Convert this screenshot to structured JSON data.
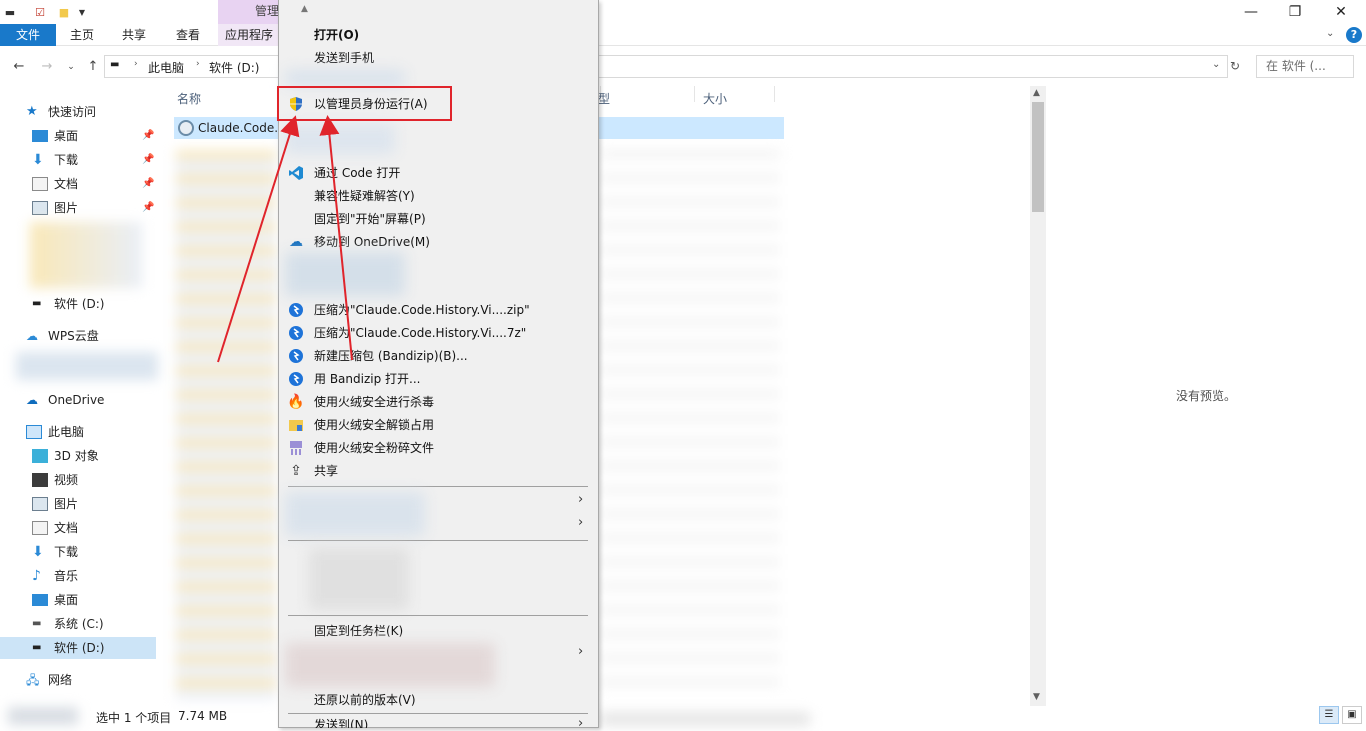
{
  "ribbon": {
    "manage_label": "管理",
    "tabs": [
      "文件",
      "主页",
      "共享",
      "查看",
      "应用程序"
    ]
  },
  "window_controls": {
    "minimize": "—",
    "maximize": "❐",
    "close": "✕"
  },
  "address": {
    "crumbs": [
      "此电脑",
      "软件 (D:)"
    ],
    "search_placeholder": "在 软件 (..."
  },
  "nav": {
    "quick_access": "快速访问",
    "pinned": [
      "桌面",
      "下载",
      "文档",
      "图片"
    ],
    "drive_d_quick": "软件 (D:)",
    "wps": "WPS云盘",
    "onedrive": "OneDrive",
    "this_pc": "此电脑",
    "pc_items": [
      "3D 对象",
      "视频",
      "图片",
      "文档",
      "下载",
      "音乐",
      "桌面",
      "系统 (C:)",
      "软件 (D:)"
    ],
    "network": "网络"
  },
  "list": {
    "col_name": "名称",
    "col_type": "型",
    "col_size": "大小",
    "first_file": "Claude.Code.H"
  },
  "preview": {
    "text": "没有预览。"
  },
  "status": {
    "selected": "选中 1 个项目",
    "size": "7.74 MB"
  },
  "context_menu": {
    "open": "打开(O)",
    "send_to_phone": "发送到手机",
    "run_as_admin": "以管理员身份运行(A)",
    "open_with_code": "通过 Code 打开",
    "troubleshoot": "兼容性疑难解答(Y)",
    "pin_start": "固定到\"开始\"屏幕(P)",
    "move_onedrive": "移动到 OneDrive(M)",
    "compress_zip": "压缩为\"Claude.Code.History.Vi....zip\"",
    "compress_7z": "压缩为\"Claude.Code.History.Vi....7z\"",
    "new_archive": "新建压缩包 (Bandizip)(B)...",
    "open_bandizip": "用 Bandizip 打开...",
    "huorong_scan": "使用火绒安全进行杀毒",
    "huorong_unlock": "使用火绒安全解锁占用",
    "huorong_shred": "使用火绒安全粉碎文件",
    "share": "共享",
    "pin_taskbar": "固定到任务栏(K)",
    "restore_prev": "还原以前的版本(V)",
    "send_to": "发送到(N)"
  },
  "colors": {
    "accent": "#1979ca",
    "highlight": "#e0242b",
    "manage_tab": "#e8d3f2"
  }
}
